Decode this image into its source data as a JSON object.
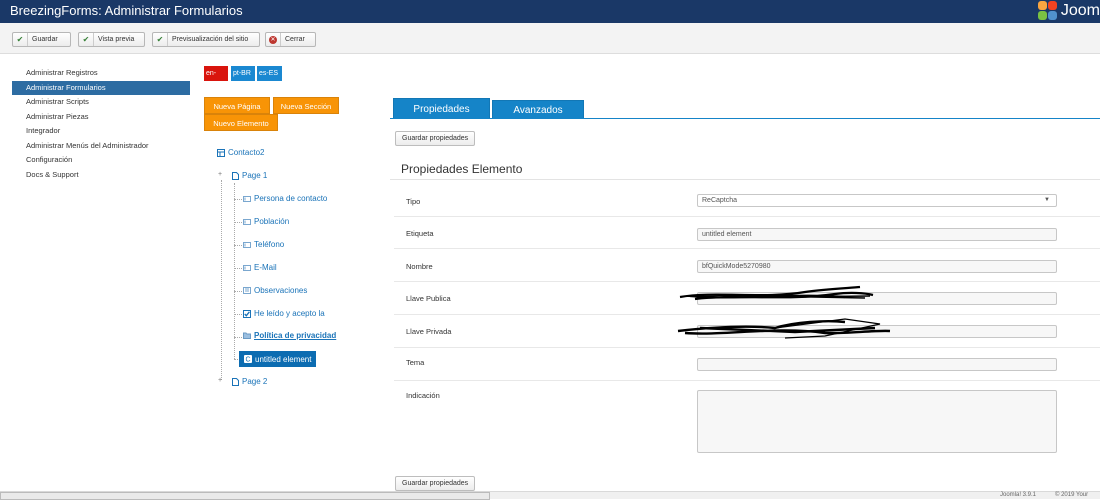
{
  "header": {
    "title": "BreezingForms: Administrar Formularios",
    "logo_text": "Joom"
  },
  "toolbar": {
    "save": "Guardar",
    "preview": "Vista previa",
    "site_preview": "Previsualización del sitio",
    "close": "Cerrar"
  },
  "sidebar": {
    "items": [
      {
        "label": "Administrar Registros",
        "active": false
      },
      {
        "label": "Administrar Formularios",
        "active": true
      },
      {
        "label": "Administrar Scripts",
        "active": false
      },
      {
        "label": "Administrar Piezas",
        "active": false
      },
      {
        "label": "Integrador",
        "active": false
      },
      {
        "label": "Administrar Menús del Administrador",
        "active": false
      },
      {
        "label": "Configuración",
        "active": false
      },
      {
        "label": "Docs & Support",
        "active": false
      }
    ]
  },
  "languages": [
    "en-GB",
    "pt-BR",
    "es-ES"
  ],
  "actions": {
    "new_page": "Nueva Página",
    "new_section": "Nueva Sección",
    "new_element": "Nuevo Elemento"
  },
  "tree": {
    "form": "Contacto2",
    "page1": "Page 1",
    "elements": [
      "Persona de contacto",
      "Población",
      "Teléfono",
      "E-Mail",
      "Observaciones",
      "He leído y acepto la",
      "Política de privacidad",
      "untitled element"
    ],
    "page2": "Page 2"
  },
  "tabs": {
    "properties": "Propiedades",
    "advanced": "Avanzados"
  },
  "save_properties": "Guardar propiedades",
  "section_title": "Propiedades Elemento",
  "fields": {
    "tipo": {
      "label": "Tipo",
      "value": "ReCaptcha"
    },
    "etiqueta": {
      "label": "Etiqueta",
      "value": "untitled element"
    },
    "nombre": {
      "label": "Nombre",
      "value": "bfQuickMode5270980"
    },
    "llave_publica": {
      "label": "Llave Publica",
      "value": ""
    },
    "llave_privada": {
      "label": "Llave Privada",
      "value": ""
    },
    "tema": {
      "label": "Tema",
      "value": ""
    },
    "indicacion": {
      "label": "Indicación",
      "value": ""
    }
  },
  "status": {
    "version": "Joomla! 3.9.1",
    "copyright": "© 2019 Your"
  },
  "colors": {
    "header_bg": "#1a3867",
    "accent": "#1584c8",
    "orange": "#f89406",
    "active_side": "#2d6ca2"
  }
}
